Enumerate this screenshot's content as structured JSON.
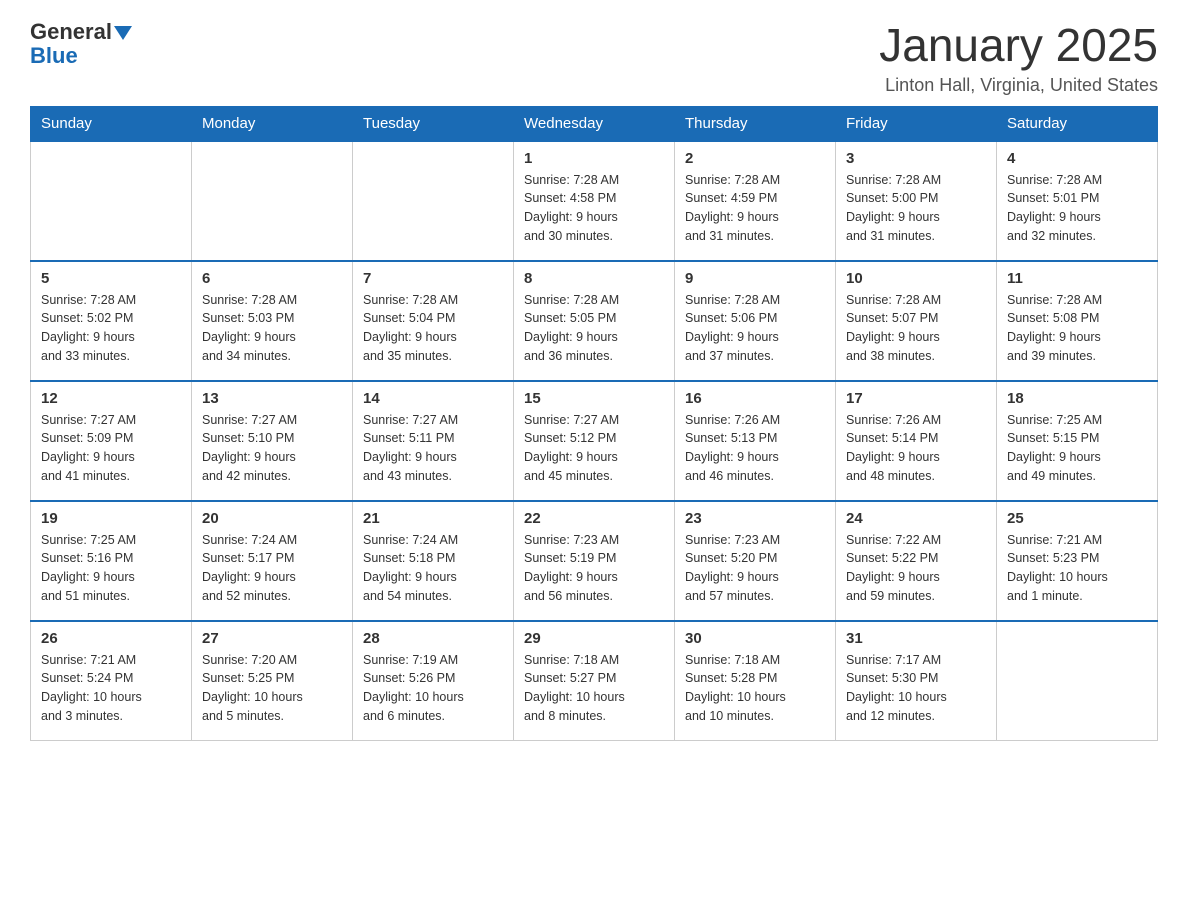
{
  "header": {
    "logo_general": "General",
    "logo_blue": "Blue",
    "month_title": "January 2025",
    "location": "Linton Hall, Virginia, United States"
  },
  "days_of_week": [
    "Sunday",
    "Monday",
    "Tuesday",
    "Wednesday",
    "Thursday",
    "Friday",
    "Saturday"
  ],
  "weeks": [
    [
      {
        "day": "",
        "info": ""
      },
      {
        "day": "",
        "info": ""
      },
      {
        "day": "",
        "info": ""
      },
      {
        "day": "1",
        "info": "Sunrise: 7:28 AM\nSunset: 4:58 PM\nDaylight: 9 hours\nand 30 minutes."
      },
      {
        "day": "2",
        "info": "Sunrise: 7:28 AM\nSunset: 4:59 PM\nDaylight: 9 hours\nand 31 minutes."
      },
      {
        "day": "3",
        "info": "Sunrise: 7:28 AM\nSunset: 5:00 PM\nDaylight: 9 hours\nand 31 minutes."
      },
      {
        "day": "4",
        "info": "Sunrise: 7:28 AM\nSunset: 5:01 PM\nDaylight: 9 hours\nand 32 minutes."
      }
    ],
    [
      {
        "day": "5",
        "info": "Sunrise: 7:28 AM\nSunset: 5:02 PM\nDaylight: 9 hours\nand 33 minutes."
      },
      {
        "day": "6",
        "info": "Sunrise: 7:28 AM\nSunset: 5:03 PM\nDaylight: 9 hours\nand 34 minutes."
      },
      {
        "day": "7",
        "info": "Sunrise: 7:28 AM\nSunset: 5:04 PM\nDaylight: 9 hours\nand 35 minutes."
      },
      {
        "day": "8",
        "info": "Sunrise: 7:28 AM\nSunset: 5:05 PM\nDaylight: 9 hours\nand 36 minutes."
      },
      {
        "day": "9",
        "info": "Sunrise: 7:28 AM\nSunset: 5:06 PM\nDaylight: 9 hours\nand 37 minutes."
      },
      {
        "day": "10",
        "info": "Sunrise: 7:28 AM\nSunset: 5:07 PM\nDaylight: 9 hours\nand 38 minutes."
      },
      {
        "day": "11",
        "info": "Sunrise: 7:28 AM\nSunset: 5:08 PM\nDaylight: 9 hours\nand 39 minutes."
      }
    ],
    [
      {
        "day": "12",
        "info": "Sunrise: 7:27 AM\nSunset: 5:09 PM\nDaylight: 9 hours\nand 41 minutes."
      },
      {
        "day": "13",
        "info": "Sunrise: 7:27 AM\nSunset: 5:10 PM\nDaylight: 9 hours\nand 42 minutes."
      },
      {
        "day": "14",
        "info": "Sunrise: 7:27 AM\nSunset: 5:11 PM\nDaylight: 9 hours\nand 43 minutes."
      },
      {
        "day": "15",
        "info": "Sunrise: 7:27 AM\nSunset: 5:12 PM\nDaylight: 9 hours\nand 45 minutes."
      },
      {
        "day": "16",
        "info": "Sunrise: 7:26 AM\nSunset: 5:13 PM\nDaylight: 9 hours\nand 46 minutes."
      },
      {
        "day": "17",
        "info": "Sunrise: 7:26 AM\nSunset: 5:14 PM\nDaylight: 9 hours\nand 48 minutes."
      },
      {
        "day": "18",
        "info": "Sunrise: 7:25 AM\nSunset: 5:15 PM\nDaylight: 9 hours\nand 49 minutes."
      }
    ],
    [
      {
        "day": "19",
        "info": "Sunrise: 7:25 AM\nSunset: 5:16 PM\nDaylight: 9 hours\nand 51 minutes."
      },
      {
        "day": "20",
        "info": "Sunrise: 7:24 AM\nSunset: 5:17 PM\nDaylight: 9 hours\nand 52 minutes."
      },
      {
        "day": "21",
        "info": "Sunrise: 7:24 AM\nSunset: 5:18 PM\nDaylight: 9 hours\nand 54 minutes."
      },
      {
        "day": "22",
        "info": "Sunrise: 7:23 AM\nSunset: 5:19 PM\nDaylight: 9 hours\nand 56 minutes."
      },
      {
        "day": "23",
        "info": "Sunrise: 7:23 AM\nSunset: 5:20 PM\nDaylight: 9 hours\nand 57 minutes."
      },
      {
        "day": "24",
        "info": "Sunrise: 7:22 AM\nSunset: 5:22 PM\nDaylight: 9 hours\nand 59 minutes."
      },
      {
        "day": "25",
        "info": "Sunrise: 7:21 AM\nSunset: 5:23 PM\nDaylight: 10 hours\nand 1 minute."
      }
    ],
    [
      {
        "day": "26",
        "info": "Sunrise: 7:21 AM\nSunset: 5:24 PM\nDaylight: 10 hours\nand 3 minutes."
      },
      {
        "day": "27",
        "info": "Sunrise: 7:20 AM\nSunset: 5:25 PM\nDaylight: 10 hours\nand 5 minutes."
      },
      {
        "day": "28",
        "info": "Sunrise: 7:19 AM\nSunset: 5:26 PM\nDaylight: 10 hours\nand 6 minutes."
      },
      {
        "day": "29",
        "info": "Sunrise: 7:18 AM\nSunset: 5:27 PM\nDaylight: 10 hours\nand 8 minutes."
      },
      {
        "day": "30",
        "info": "Sunrise: 7:18 AM\nSunset: 5:28 PM\nDaylight: 10 hours\nand 10 minutes."
      },
      {
        "day": "31",
        "info": "Sunrise: 7:17 AM\nSunset: 5:30 PM\nDaylight: 10 hours\nand 12 minutes."
      },
      {
        "day": "",
        "info": ""
      }
    ]
  ]
}
